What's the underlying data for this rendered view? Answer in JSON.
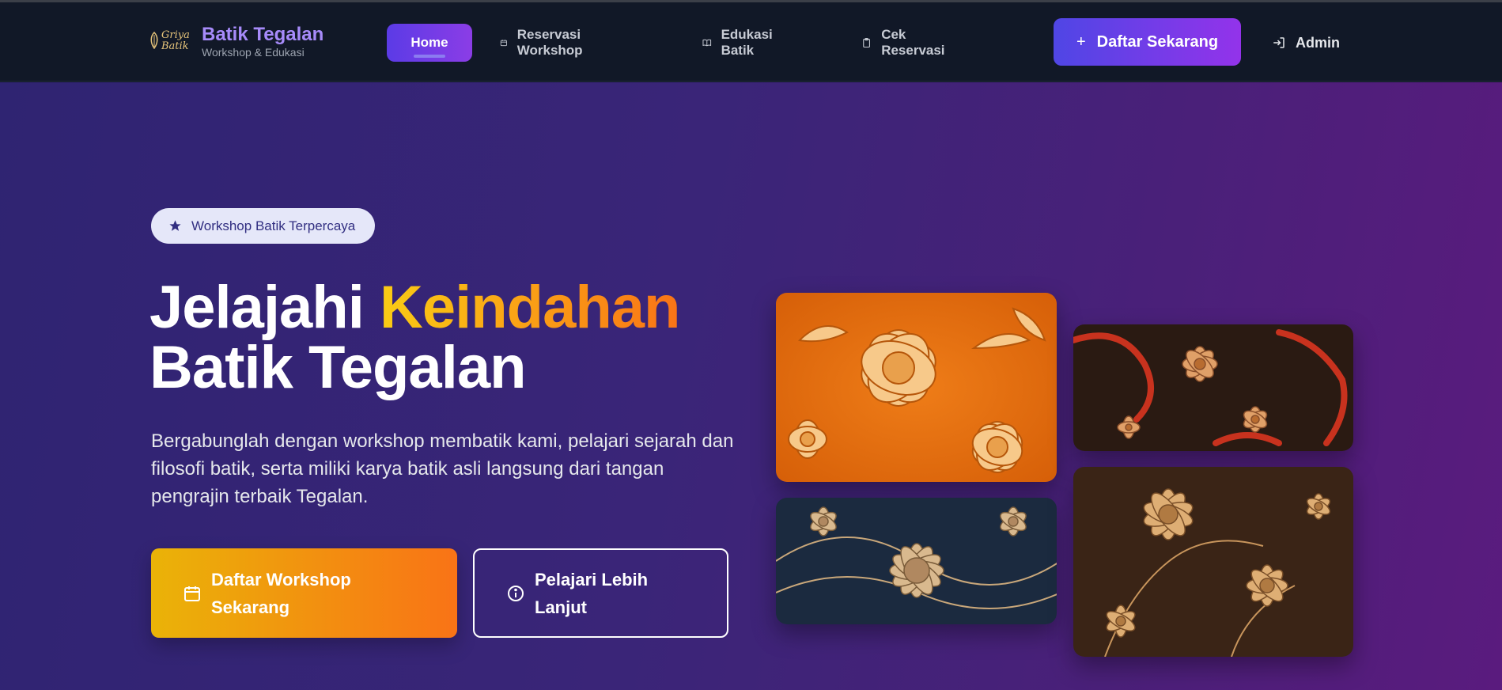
{
  "brand": {
    "logo_line1": "Griya",
    "logo_line2": "Batik",
    "title": "Batik Tegalan",
    "subtitle": "Workshop & Edukasi"
  },
  "nav": {
    "home": "Home",
    "items": [
      {
        "label": "Reservasi Workshop",
        "icon": "calendar-icon"
      },
      {
        "label": "Edukasi Batik",
        "icon": "book-icon"
      },
      {
        "label": "Cek Reservasi",
        "icon": "clipboard-icon"
      }
    ],
    "cta": "Daftar Sekarang",
    "admin": "Admin"
  },
  "hero": {
    "badge": "Workshop Batik Terpercaya",
    "headline_part1": "Jelajahi ",
    "headline_accent": "Keindahan",
    "headline_line2": "Batik Tegalan",
    "lead": "Bergabunglah dengan workshop membatik kami, pelajari sejarah dan filosofi batik, serta miliki karya batik asli langsung dari tangan pengrajin terbaik Tegalan.",
    "primary_button": "Daftar Workshop Sekarang",
    "secondary_button": "Pelajari Lebih Lanjut"
  },
  "gallery": [
    {
      "name": "orange-floral-batik"
    },
    {
      "name": "red-brown-bird-batik"
    },
    {
      "name": "navy-floral-batik"
    },
    {
      "name": "brown-floral-batik"
    }
  ],
  "colors": {
    "nav_bg": "#111827",
    "brand_accent": "#a78bfa",
    "primary_gradient_start": "#eab308",
    "primary_gradient_end": "#f97316",
    "cta_gradient_start": "#4f46e5",
    "cta_gradient_end": "#9333ea"
  }
}
